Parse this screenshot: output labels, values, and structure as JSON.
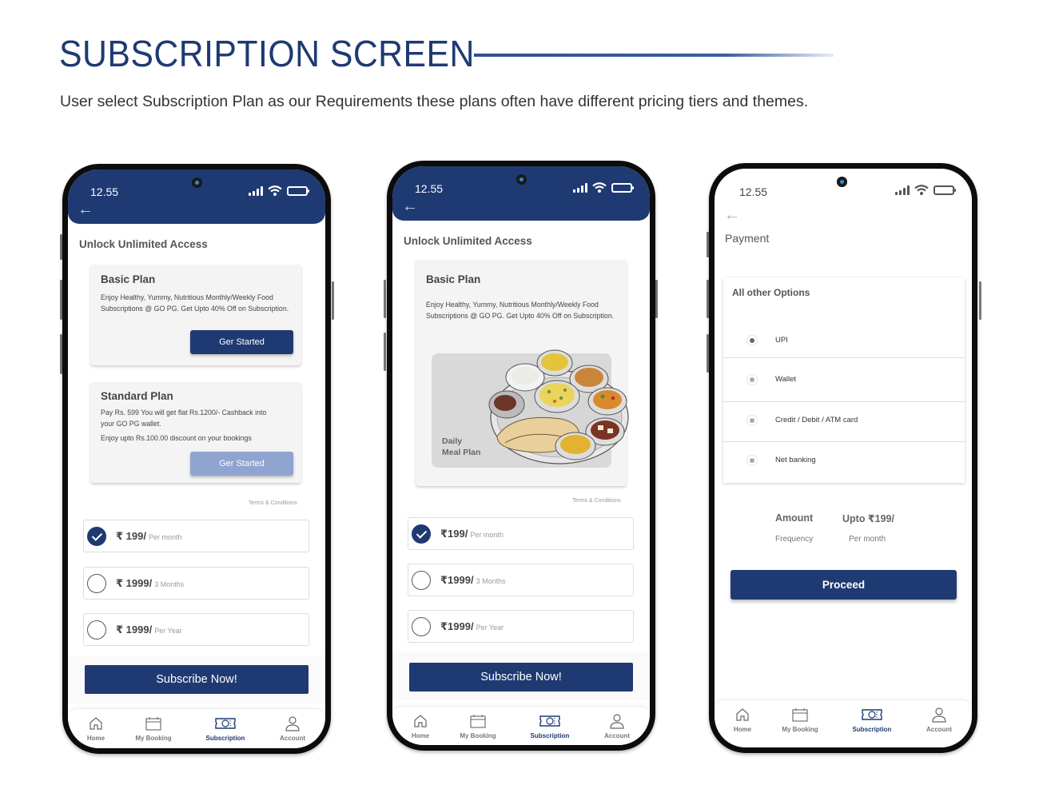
{
  "header": {
    "title": "SUBSCRIPTION SCREEN",
    "subtitle": "User select Subscription Plan as our Requirements these plans often have different pricing tiers and themes."
  },
  "colors": {
    "brand": "#1f3a72",
    "muted_button": "#8fa4cf"
  },
  "status_bar": {
    "time": "12.55",
    "icons": [
      "signal-icon",
      "wifi-icon",
      "battery-icon"
    ]
  },
  "bottom_nav": {
    "items": [
      {
        "label": "Home",
        "icon": "home-icon",
        "active": false
      },
      {
        "label": "My Booking",
        "icon": "calendar-icon",
        "active": false
      },
      {
        "label": "Subscription",
        "icon": "ticket-icon",
        "active": true
      },
      {
        "label": "Account",
        "icon": "user-icon",
        "active": false
      }
    ]
  },
  "screen1": {
    "heading": "Unlock Unlimited Access",
    "basic_plan": {
      "title": "Basic Plan",
      "desc": "Enjoy Healthy, Yummy, Nutritious Monthly/Weekly Food Subscriptions @ GO PG. Get Upto 40% Off on Subscription.",
      "button": "Ger Started"
    },
    "standard_plan": {
      "title": "Standard Plan",
      "desc1": "Pay Rs. 599 You will get flat Rs.1200/- Cashback into your GO PG wallet.",
      "desc2": "Enjoy upto Rs.100.00 discount on your bookings",
      "button": "Ger Started"
    },
    "terms": "Terms & Conditions",
    "prices": [
      {
        "amount": "₹ 199/",
        "period": "Per month",
        "selected": true
      },
      {
        "amount": "₹ 1999/",
        "period": "3 Months",
        "selected": false
      },
      {
        "amount": "₹ 1999/",
        "period": "Per Year",
        "selected": false
      }
    ],
    "subscribe": "Subscribe Now!"
  },
  "screen2": {
    "heading": "Unlock Unlimited Access",
    "basic_plan": {
      "title": "Basic Plan",
      "desc": "Enjoy Healthy, Yummy, Nutritious Monthly/Weekly Food Subscriptions @ GO PG. Get Upto 40% Off on Subscription.",
      "image_label_1": "Daily",
      "image_label_2": "Meal Plan",
      "image": "thali-meal-illustration"
    },
    "terms": "Terms & Conditions",
    "prices": [
      {
        "amount": "₹199/",
        "period": "Per month",
        "selected": true
      },
      {
        "amount": "₹1999/",
        "period": "3 Months",
        "selected": false
      },
      {
        "amount": "₹1999/",
        "period": "Per Year",
        "selected": false
      }
    ],
    "subscribe": "Subscribe Now!"
  },
  "screen3": {
    "heading": "Payment",
    "options_title": "All other Options",
    "options": [
      {
        "label": "UPI",
        "selected": true
      },
      {
        "label": "Wallet",
        "selected": false
      },
      {
        "label": "Credit / Debit / ATM card",
        "selected": false
      },
      {
        "label": "Net banking",
        "selected": false
      }
    ],
    "amount_label": "Amount",
    "amount_value": "Upto ₹199/",
    "frequency_label": "Frequency",
    "frequency_value": "Per month",
    "proceed": "Proceed"
  }
}
